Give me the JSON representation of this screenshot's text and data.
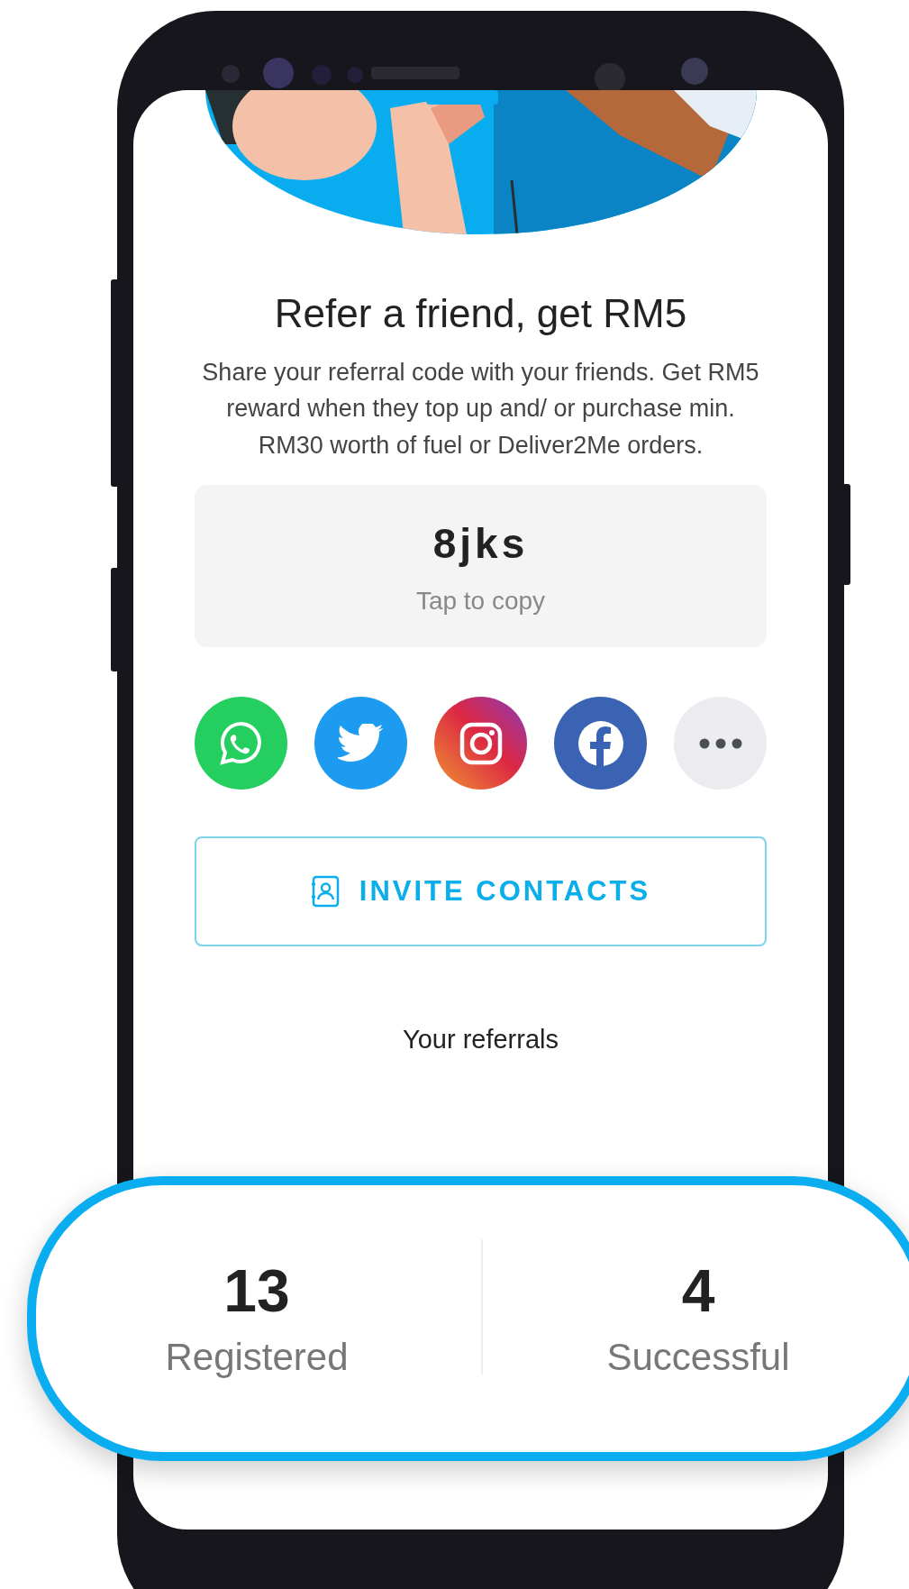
{
  "title": "Refer a friend, get RM5",
  "description": "Share your referral code with your friends. Get RM5 reward when they top up and/ or purchase min. RM30 worth of fuel or Deliver2Me orders.",
  "referral_code": {
    "code": "8jks",
    "hint": "Tap to copy"
  },
  "share_buttons": [
    {
      "kind": "whatsapp"
    },
    {
      "kind": "twitter"
    },
    {
      "kind": "instagram"
    },
    {
      "kind": "facebook"
    },
    {
      "kind": "more"
    }
  ],
  "invite_button": {
    "label": "INVITE CONTACTS"
  },
  "referrals": {
    "heading": "Your referrals",
    "stats": [
      {
        "value": "13",
        "label": "Registered"
      },
      {
        "value": "4",
        "label": "Successful"
      }
    ]
  }
}
